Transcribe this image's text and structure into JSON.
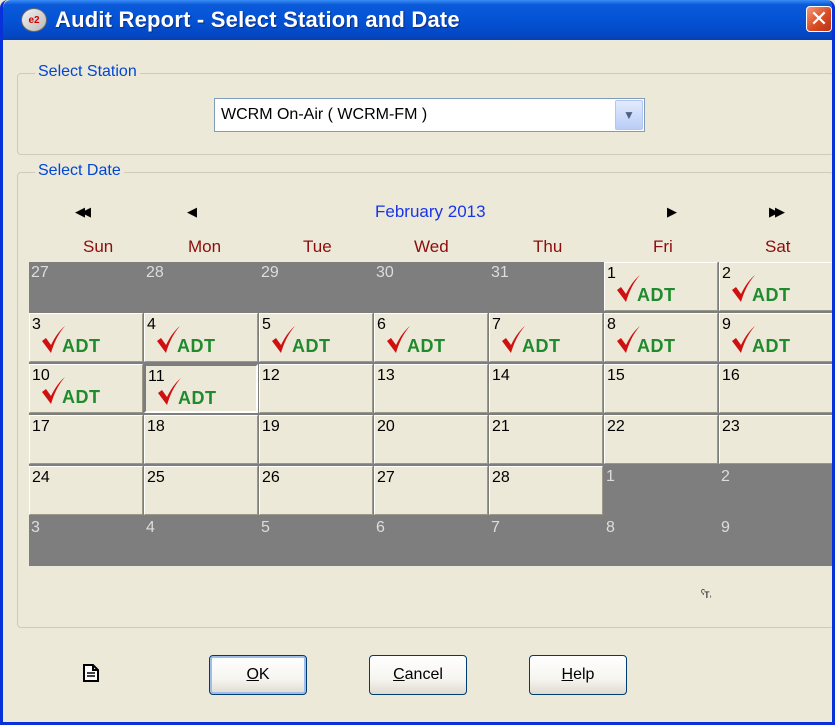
{
  "window": {
    "title": "Audit Report - Select Station and Date",
    "close_glyph": "✕"
  },
  "station_group": {
    "label": "Select Station",
    "selected": "WCRM On-Air ( WCRM-FM )",
    "dropdown_glyph": "▼"
  },
  "date_group": {
    "label": "Select Date",
    "nav": {
      "prev_year": "◀◀",
      "prev_month": "◀",
      "next_month": "▶",
      "next_year": "▶▶"
    },
    "month": "February 2013",
    "weekdays": [
      "Sun",
      "Mon",
      "Tue",
      "Wed",
      "Thu",
      "Fri",
      "Sat"
    ],
    "weeks": [
      [
        {
          "d": "27",
          "other": true
        },
        {
          "d": "28",
          "other": true
        },
        {
          "d": "29",
          "other": true
        },
        {
          "d": "30",
          "other": true
        },
        {
          "d": "31",
          "other": true
        },
        {
          "d": "1",
          "adt": true
        },
        {
          "d": "2",
          "adt": true
        }
      ],
      [
        {
          "d": "3",
          "adt": true
        },
        {
          "d": "4",
          "adt": true
        },
        {
          "d": "5",
          "adt": true
        },
        {
          "d": "6",
          "adt": true
        },
        {
          "d": "7",
          "adt": true
        },
        {
          "d": "8",
          "adt": true
        },
        {
          "d": "9",
          "adt": true
        }
      ],
      [
        {
          "d": "10",
          "adt": true
        },
        {
          "d": "11",
          "adt": true,
          "today": true
        },
        {
          "d": "12"
        },
        {
          "d": "13"
        },
        {
          "d": "14"
        },
        {
          "d": "15"
        },
        {
          "d": "16"
        }
      ],
      [
        {
          "d": "17"
        },
        {
          "d": "18"
        },
        {
          "d": "19"
        },
        {
          "d": "20"
        },
        {
          "d": "21"
        },
        {
          "d": "22"
        },
        {
          "d": "23"
        }
      ],
      [
        {
          "d": "24"
        },
        {
          "d": "25"
        },
        {
          "d": "26"
        },
        {
          "d": "27"
        },
        {
          "d": "28"
        },
        {
          "d": "1",
          "other": true
        },
        {
          "d": "2",
          "other": true
        }
      ],
      [
        {
          "d": "3",
          "other": true
        },
        {
          "d": "4",
          "other": true
        },
        {
          "d": "5",
          "other": true
        },
        {
          "d": "6",
          "other": true
        },
        {
          "d": "7",
          "other": true
        },
        {
          "d": "8",
          "other": true
        },
        {
          "d": "9",
          "other": true
        }
      ]
    ],
    "adt_label": "ADT",
    "mini_glyph": "ˤᴛ˒"
  },
  "buttons": {
    "ok": {
      "mnemonic": "O",
      "rest": "K"
    },
    "cancel": {
      "mnemonic": "C",
      "rest": "ancel"
    },
    "help": {
      "mnemonic": "H",
      "rest": "elp"
    }
  },
  "colors": {
    "title_bar": "#0453d6",
    "group_label": "#0046d5",
    "month_title": "#1a35e8",
    "weekday": "#8b0d0d",
    "adt_text": "#1f8b2e",
    "adt_check": "#d01010",
    "other_month": "#7e7e7e"
  },
  "icons": [
    "app-icon",
    "close-icon",
    "dropdown-arrow-icon",
    "prev-year-icon",
    "prev-month-icon",
    "next-month-icon",
    "next-year-icon",
    "check-icon",
    "document-icon"
  ]
}
